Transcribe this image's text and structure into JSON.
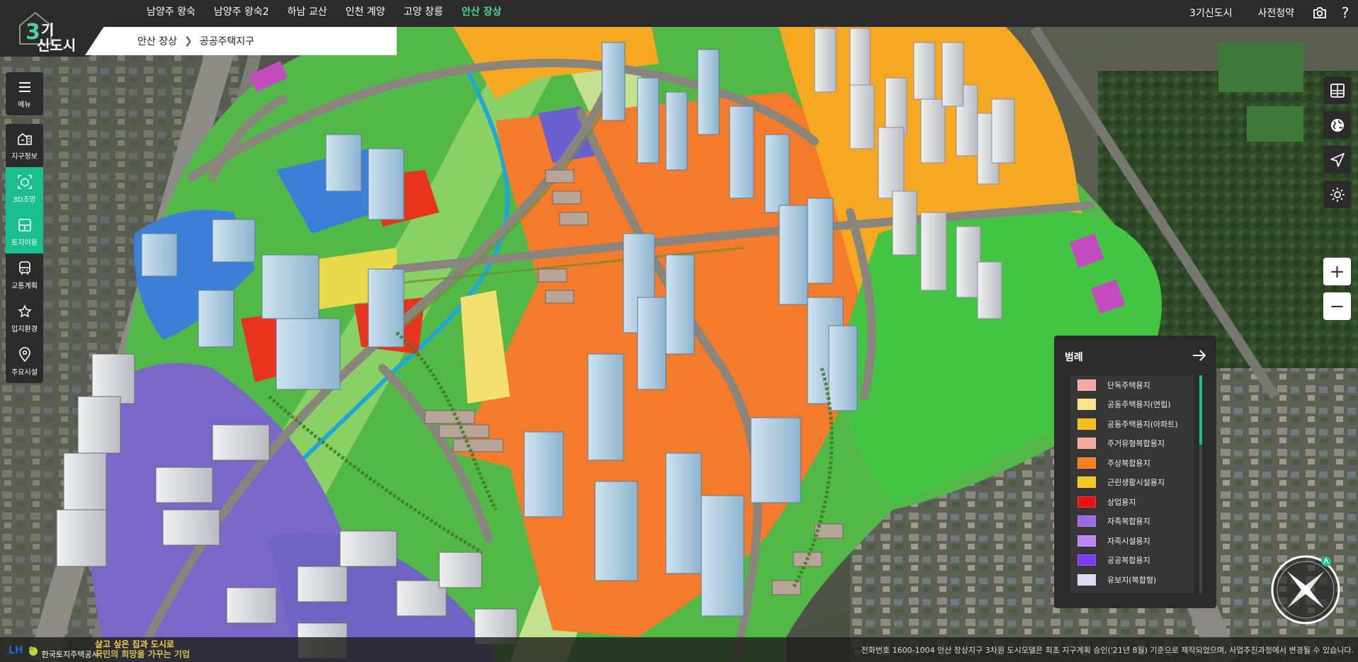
{
  "header": {
    "logo": {
      "number": "3",
      "text_top": "기",
      "text_bottom": "신도시"
    },
    "nav": [
      {
        "label": "남양주 왕숙",
        "active": false
      },
      {
        "label": "남양주 왕숙2",
        "active": false
      },
      {
        "label": "하남 교산",
        "active": false
      },
      {
        "label": "인천 계양",
        "active": false
      },
      {
        "label": "고양 창릉",
        "active": false
      },
      {
        "label": "안산 장상",
        "active": true
      }
    ],
    "right_links": [
      "3기신도시",
      "사전청약"
    ],
    "right_icons": [
      "camera-icon",
      "help-icon"
    ],
    "help_glyph": "?"
  },
  "breadcrumb": {
    "district": "안산 장상",
    "sub": "공공주택지구"
  },
  "sidebar": {
    "groups": [
      [
        {
          "label": "메뉴",
          "icon": "menu-icon",
          "active": false
        }
      ],
      [
        {
          "label": "지구정보",
          "icon": "district-info-icon",
          "active": false
        },
        {
          "label": "3D조망",
          "icon": "view-3d-icon",
          "active": true
        },
        {
          "label": "토지이용",
          "icon": "land-use-icon",
          "active": true
        },
        {
          "label": "교통계획",
          "icon": "bus-icon",
          "active": false
        },
        {
          "label": "입지환경",
          "icon": "star-icon",
          "active": false
        },
        {
          "label": "주요시설",
          "icon": "location-pin-icon",
          "active": false
        }
      ]
    ]
  },
  "right_tools": [
    "layers-grid-icon",
    "globe-icon",
    "send-icon",
    "brightness-icon"
  ],
  "zoom": {
    "in": "+",
    "out": "−"
  },
  "legend": {
    "title": "범례",
    "items": [
      {
        "label": "단독주택용지",
        "color": "#f4a8a4"
      },
      {
        "label": "공동주택용지(연립)",
        "color": "#fbe08e"
      },
      {
        "label": "공동주택용지(아파트)",
        "color": "#f7bd18"
      },
      {
        "label": "주거유형복합용지",
        "color": "#f5a8a0"
      },
      {
        "label": "주상복합용지",
        "color": "#f77d1e"
      },
      {
        "label": "근린생활시설용지",
        "color": "#f7c71c"
      },
      {
        "label": "상업용지",
        "color": "#ee0f0f"
      },
      {
        "label": "자족복합용지",
        "color": "#9a6ae0"
      },
      {
        "label": "자족시설용지",
        "color": "#c083f0"
      },
      {
        "label": "공공복합용지",
        "color": "#7a3cf2"
      },
      {
        "label": "유보지(복합형)",
        "color": "#e0d8f0"
      }
    ]
  },
  "footer": {
    "lh_mark": "LH",
    "lh_name": "한국토지주택공사",
    "slogan_1": "살고 싶은 집과 도시로",
    "slogan_2": "국민의 희망을 가꾸는 기업",
    "notice": "전화번호 1600-1004   안산 장상지구 3차원 도시모델은 최초 지구계획 승인('21년 8월) 기준으로 제작되었으며, 사업추진과정에서 변경될 수 있습니다."
  }
}
